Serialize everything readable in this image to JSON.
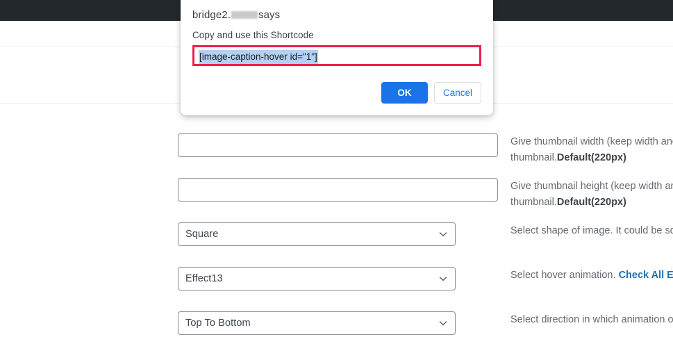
{
  "admin_bar": {
    "color": "#23282d"
  },
  "dialog": {
    "title_prefix": "bridge2.",
    "title_suffix": "says",
    "message": "Copy and use this Shortcode",
    "input_value": "[image-caption-hover id=\"1\"]",
    "ok_label": "OK",
    "cancel_label": "Cancel",
    "highlight_color": "#ec1f4d",
    "primary_color": "#1a73e8"
  },
  "form": {
    "rows": [
      {
        "kind": "text",
        "value": "",
        "placeholder": "",
        "desc_line1": "Give thumbnail width (keep width and",
        "desc_line2_pre": "thumbnail.",
        "desc_line2_bold": "Default(220px)"
      },
      {
        "kind": "text",
        "value": "",
        "placeholder": "",
        "desc_line1": "Give thumbnail height (keep width an",
        "desc_line2_pre": "thumbnail.",
        "desc_line2_bold": "Default(220px)"
      },
      {
        "kind": "select",
        "value": "Square",
        "desc_line1": "Select shape of image. It could be squ",
        "desc_line2_pre": "",
        "desc_line2_bold": ""
      },
      {
        "kind": "select",
        "value": "Effect13",
        "desc_line1": "Select hover animation. ",
        "desc_link": "Check All Eff",
        "desc_line2_pre": "",
        "desc_line2_bold": ""
      },
      {
        "kind": "select",
        "value": "Top To Bottom",
        "desc_line1": "Select direction in which animation oc",
        "desc_line2_pre": "",
        "desc_line2_bold": ""
      }
    ]
  },
  "icons": {
    "chevron_down": "chevron-down-icon"
  }
}
